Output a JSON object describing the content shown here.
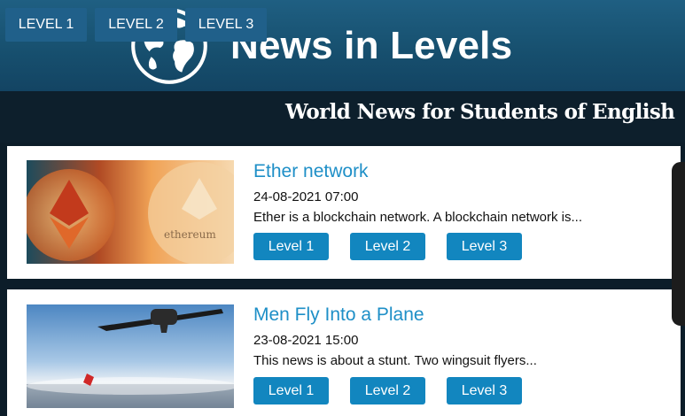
{
  "header": {
    "title": "News in Levels"
  },
  "nav": {
    "tabs": [
      {
        "label": "LEVEL 1"
      },
      {
        "label": "LEVEL 2"
      },
      {
        "label": "LEVEL 3"
      }
    ],
    "tagline": "World News for Students of English"
  },
  "articles": [
    {
      "title": "Ether network",
      "date": "24-08-2021 07:00",
      "excerpt": "Ether is a blockchain network. A blockchain network is...",
      "buttons": [
        "Level 1",
        "Level 2",
        "Level 3"
      ]
    },
    {
      "title": "Men Fly Into a Plane",
      "date": "23-08-2021 15:00",
      "excerpt": "This news is about a stunt. Two wingsuit flyers...",
      "buttons": [
        "Level 1",
        "Level 2",
        "Level 3"
      ]
    }
  ],
  "colors": {
    "accent": "#1286bf",
    "title_link": "#1e8fc7",
    "header_bg": "#1f5f82",
    "nav_bg": "#0d1f2c"
  }
}
